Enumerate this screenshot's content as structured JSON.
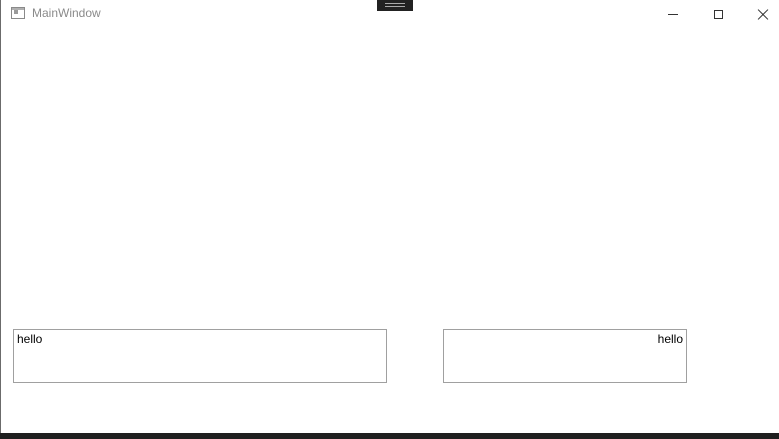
{
  "window": {
    "title": "MainWindow",
    "controls": {
      "minimize_icon": "minimize-icon",
      "maximize_icon": "maximize-icon",
      "close_icon": "close-icon"
    }
  },
  "textboxes": {
    "left": {
      "value": "hello",
      "alignment": "left"
    },
    "right": {
      "value": "hello",
      "alignment": "right"
    }
  },
  "colors": {
    "window_bg": "#ffffff",
    "border": "#a0a0a0",
    "title_text": "#8a8a8a"
  }
}
